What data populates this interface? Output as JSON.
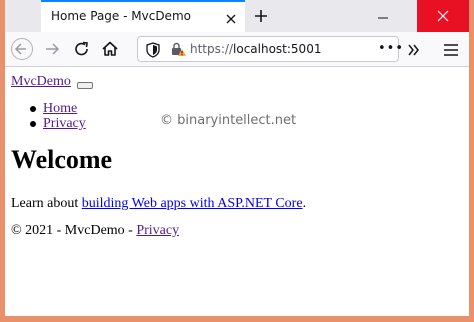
{
  "browser": {
    "tab_title": "Home Page - MvcDemo",
    "url_scheme": "https://",
    "url_host": "localhost:5001",
    "page_actions_label": "•••",
    "accent_color": "#0a84ff",
    "close_color": "#e81123",
    "frame_color": "#e8916a"
  },
  "page": {
    "brand": "MvcDemo",
    "nav_items": [
      {
        "label": "Home"
      },
      {
        "label": "Privacy"
      }
    ],
    "watermark": "© binaryintellect.net",
    "heading": "Welcome",
    "intro_prefix": "Learn about ",
    "intro_link": "building Web apps with ASP.NET Core",
    "intro_suffix": ".",
    "footer_prefix": "© 2021 - MvcDemo - ",
    "footer_link": "Privacy"
  }
}
